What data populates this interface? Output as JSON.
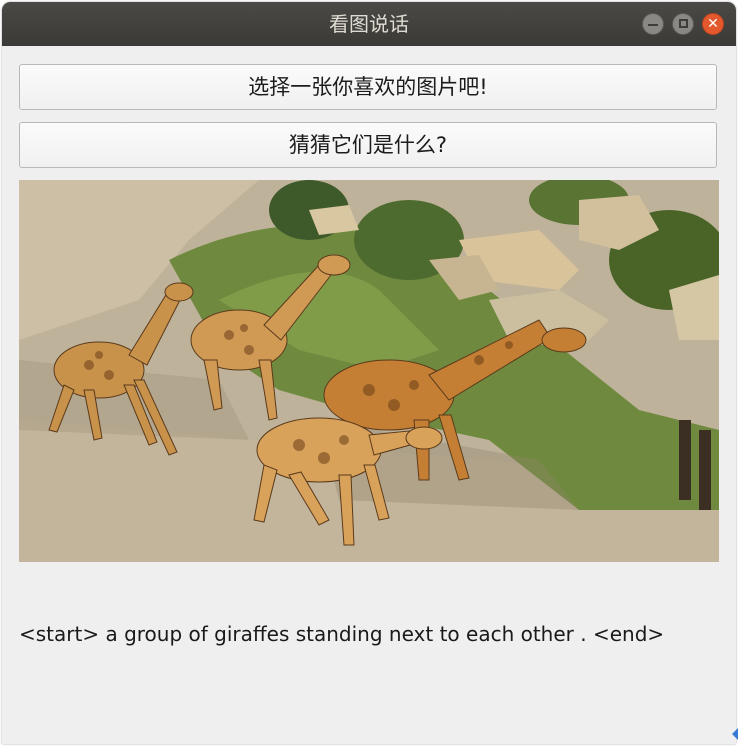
{
  "window": {
    "title": "看图说话"
  },
  "buttons": {
    "choose_image": "选择一张你喜欢的图片吧!",
    "guess": "猜猜它们是什么?"
  },
  "caption": {
    "text": "<start> a group of giraffes standing next to each other . <end>"
  },
  "colors": {
    "titlebar": "#3b3a36",
    "close_button": "#e3582d",
    "window_background": "#efefef"
  }
}
